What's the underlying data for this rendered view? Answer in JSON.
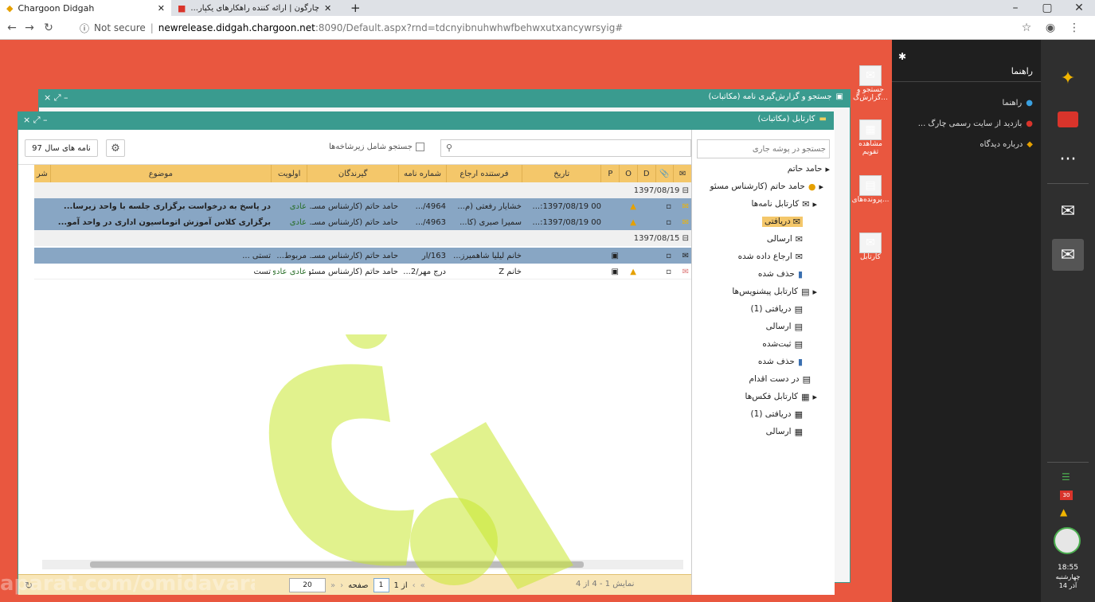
{
  "browser": {
    "tab1_title": "Chargoon Didgah",
    "tab2_title": "چارگون | ارائه کننده راهکارهای یکپار...",
    "url_prefix": "Not secure",
    "url_host": "newrelease.didgah.chargoon.net",
    "url_rest": ":8090/Default.aspx?rnd=tdcnyibnuhwhwfbehwxutxancywrsyig#"
  },
  "start_menu": {
    "header": "راهنما",
    "items": [
      "راهنما",
      "بازدید از سایت رسمی چارگ ...",
      "درباره دیدگاه"
    ]
  },
  "taskbar": {
    "time": "18:55",
    "day": "چهارشنبه",
    "date": "14 آذر",
    "badge": "30"
  },
  "desktop_icons": [
    "جستجو و گزارش‌گ...",
    "مشاهده تقویم",
    "پرونده‌های...",
    "کارتابل"
  ],
  "back_window": {
    "title": "جستجو و گزارش‌گیری نامه (مکاتبات)"
  },
  "front_window": {
    "title": "کارتابل (مکاتبات)"
  },
  "tree": {
    "search_placeholder": "جستجو در پوشه جاری",
    "root": "حامد حاتم",
    "user": "حامد حاتم (کارشناس مسئو",
    "nodes": [
      "کارتابل نامه‌ها",
      "دریافتی",
      "ارسالی",
      "ارجاع داده شده",
      "حذف شده",
      "کارتابل پیشنویس‌ها",
      "دریافتی (1)",
      "ارسالی",
      "ثبت‌شده",
      "حذف شده",
      "در دست اقدام",
      "کارتابل فکس‌ها",
      "دریافتی (1)",
      "ارسالی"
    ]
  },
  "toolbar": {
    "year_button": "نامه های سال 97",
    "search_attachments": "جستجو شامل زیرشاخه‌ها"
  },
  "grid": {
    "headers": [
      "",
      "",
      "D",
      "O",
      "P",
      "تاریخ",
      "فرستنده ارجاع",
      "شماره نامه",
      "گیرندگان",
      "اولویت",
      "موضوع",
      "شر"
    ],
    "group1": "1397/08/19",
    "group2": "1397/08/15",
    "rows": [
      {
        "date": "00 1397/08/19:...",
        "sender": "خشایار رفعتی (م...",
        "number": "4964/...",
        "recipients": "حامد حاتم (کارشناس مسـ...",
        "priority": "عادی",
        "subject": "در پاسخ به درخواست برگزاری جلسه با واحد زیرسا..."
      },
      {
        "date": "00 1397/08/19:...",
        "sender": "سمیرا صبری (کا...",
        "number": "4963/...",
        "recipients": "حامد حاتم (کارشناس مسـ...",
        "priority": "عادی",
        "subject": "برگزاری کلاس آموزش اتوماسیون اداری در واحد آمو..."
      },
      {
        "date": "",
        "sender": "خانم لیلیا شاهمیرز...",
        "number": "163/ار",
        "recipients": "حامد حاتم (کارشناس مسـ...",
        "priority": "مربوط...",
        "subject": "تستی ..."
      },
      {
        "date": "",
        "sender": "خانم Z",
        "number": "درج مهر/2...",
        "recipients": "حامد حاتم (کارشناس مسئول...",
        "priority": "عادی عادی...",
        "subject": "تست"
      }
    ]
  },
  "pager": {
    "summary": "نمایش 1 - 4 از 4",
    "page_label": "صفحه",
    "page_value": "1",
    "of_label": "از 1",
    "page_size": "20"
  },
  "watermark_text": "aparat.com/omidavaran"
}
